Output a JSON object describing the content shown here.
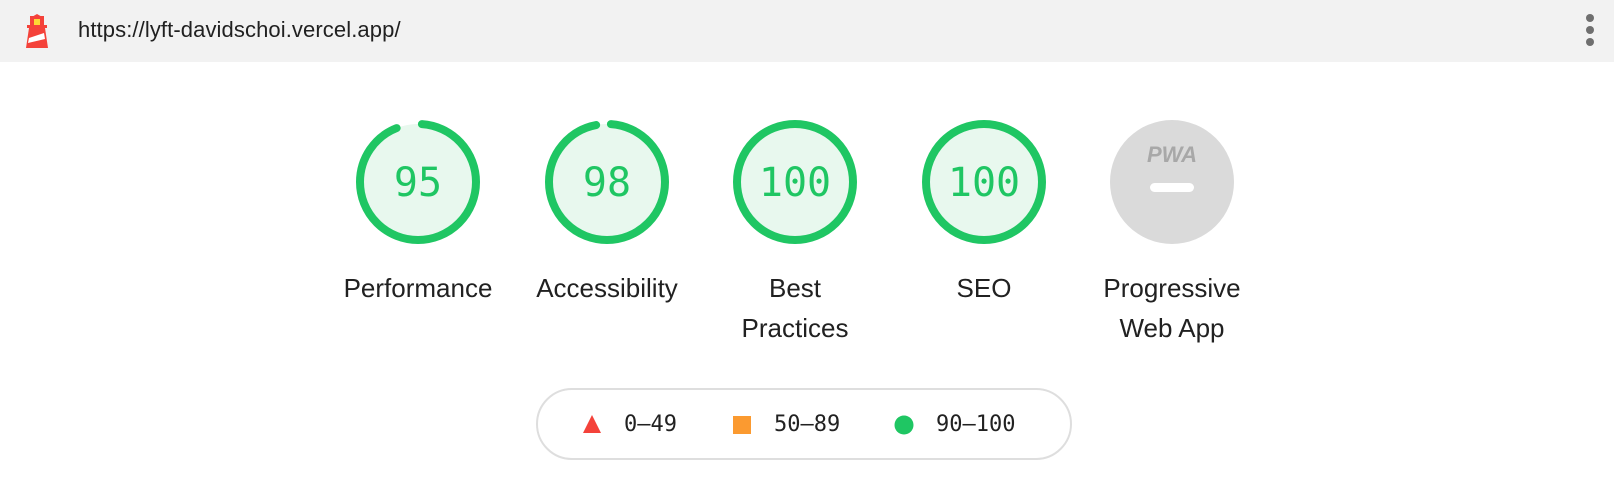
{
  "browser": {
    "url": "https://lyft-davidschoi.vercel.app/",
    "logo_icon": "lighthouse-icon",
    "menu_icon": "kebab-menu-icon"
  },
  "gauges": [
    {
      "label": "Performance",
      "score": 95,
      "score_text": "95",
      "status": "pass"
    },
    {
      "label": "Accessibility",
      "score": 98,
      "score_text": "98",
      "status": "pass"
    },
    {
      "label": "Best Practices",
      "label_lines": [
        "Best",
        "Practices"
      ],
      "score": 100,
      "score_text": "100",
      "status": "pass"
    },
    {
      "label": "SEO",
      "score": 100,
      "score_text": "100",
      "status": "pass"
    },
    {
      "label": "Progressive Web App",
      "label_lines": [
        "Progressive",
        "Web App"
      ],
      "score": null,
      "badge_text": "PWA",
      "status": "na"
    }
  ],
  "legend": {
    "items": [
      {
        "range": "0–49",
        "shape": "triangle",
        "color": "#f4423a"
      },
      {
        "range": "50–89",
        "shape": "square",
        "color": "#fb9a30"
      },
      {
        "range": "90–100",
        "shape": "circle",
        "color": "#1fc663"
      }
    ]
  },
  "colors": {
    "pass": "#1fc663",
    "pass_fill": "#e8f8ee",
    "na_fill": "#dadada",
    "na_text": "#a8a8a8"
  }
}
